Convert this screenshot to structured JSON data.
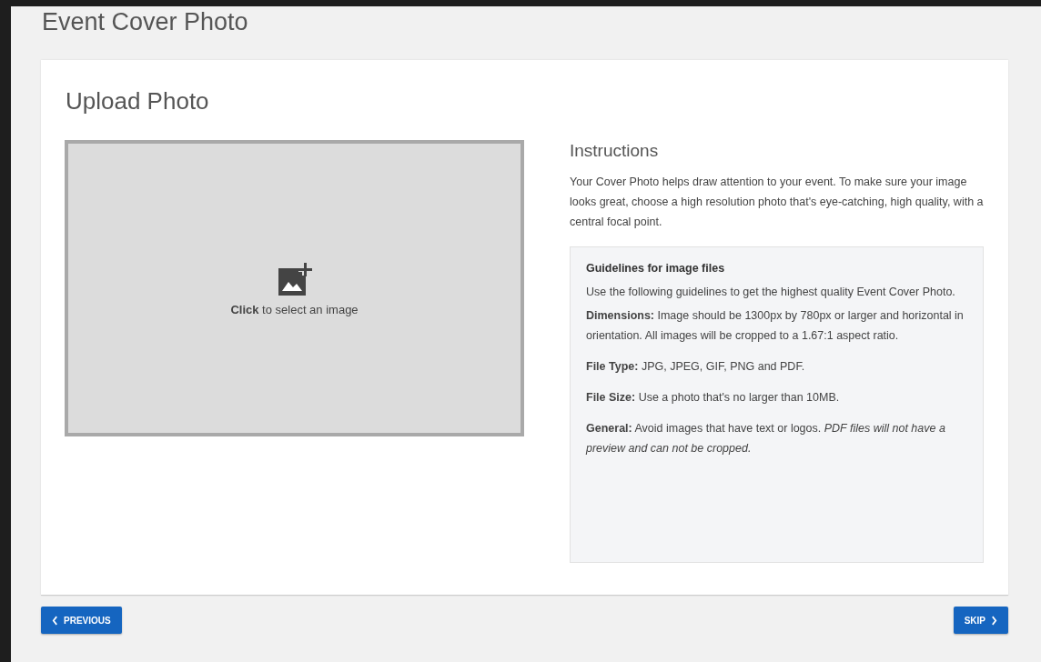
{
  "page_title": "Event Cover Photo",
  "card": {
    "title": "Upload Photo",
    "upload": {
      "prompt": "**Click** to select an image"
    },
    "instructions": {
      "heading": "Instructions",
      "text": "Your Cover Photo helps draw attention to your event. To make sure your image looks great, choose a high resolution photo that's eye-catching, high quality, with a central focal point."
    },
    "guidelines": {
      "heading": "Guidelines for image files",
      "paragraphs": [
        "Use the following guidelines to get the highest quality Event Cover Photo.",
        "**Dimensions:** Image should be 1300px by 780px or larger and horizontal in orientation. All images will be cropped to a 1.67:1 aspect ratio.",
        "**File Type:** JPG, JPEG, GIF, PNG and PDF.",
        "**File Size:** Use a photo that's no larger than 10MB.",
        "**General:** Avoid images that have text or logos. *PDF files will not have a preview and can not be cropped.*"
      ]
    }
  },
  "buttons": {
    "previous": "PREVIOUS",
    "skip": "SKIP"
  }
}
